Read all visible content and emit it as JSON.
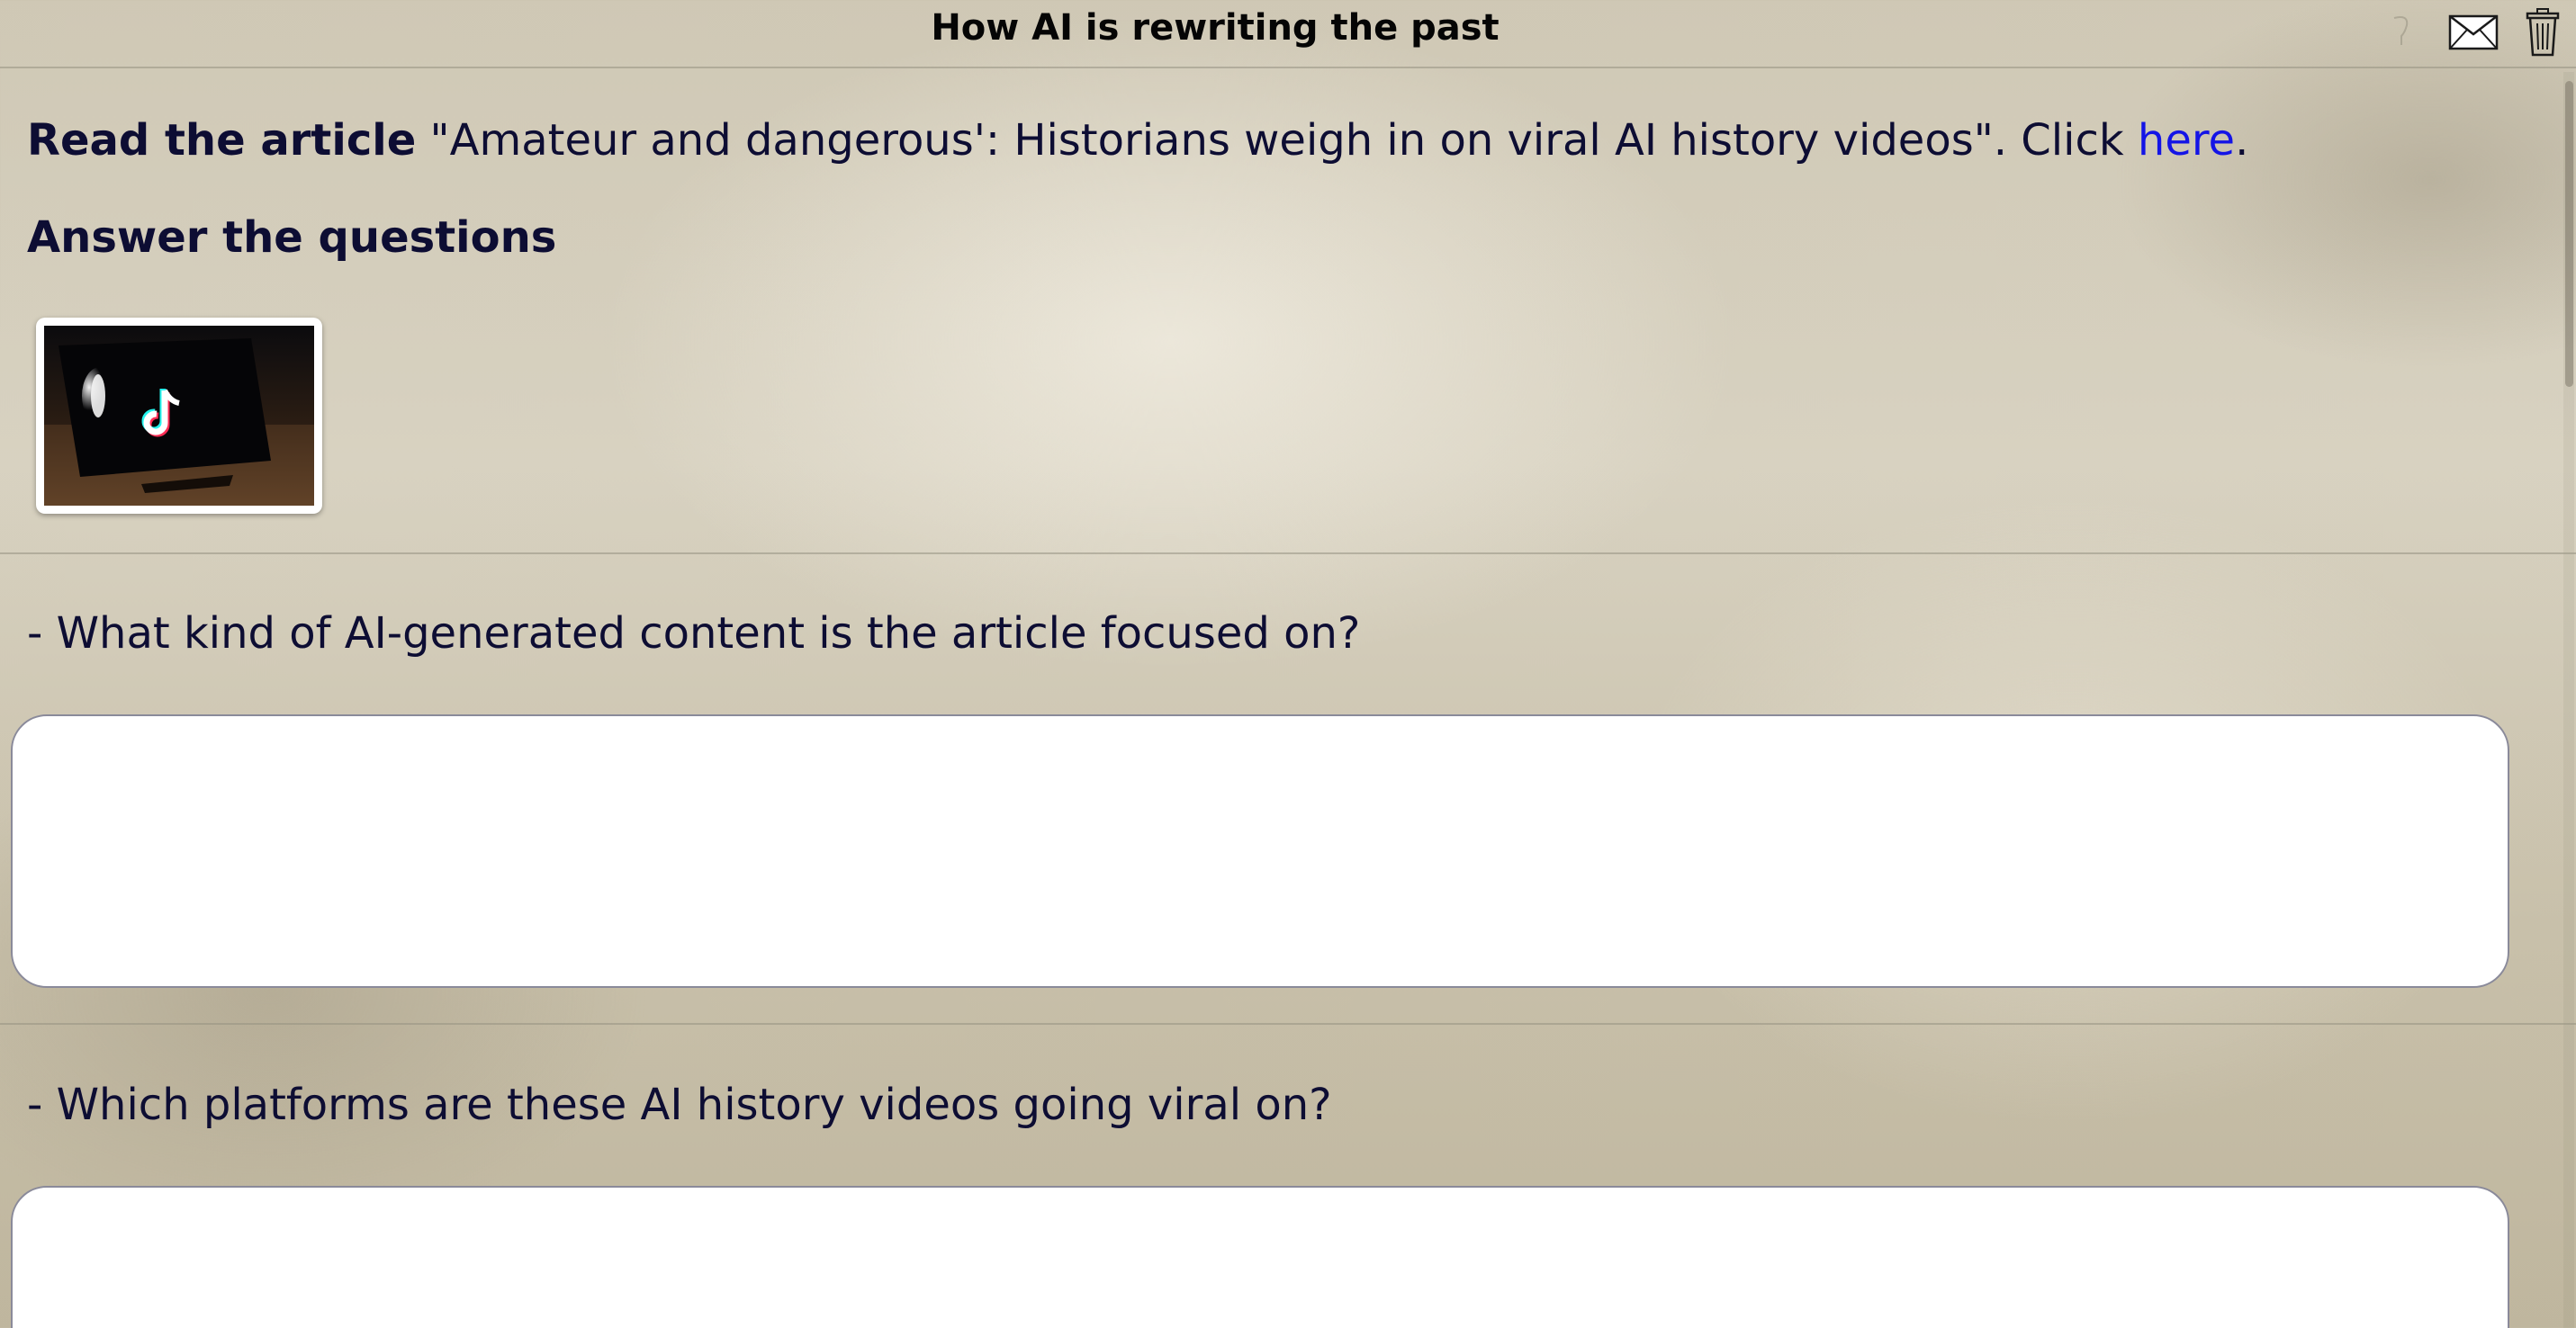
{
  "header": {
    "title": "How AI is rewriting the past",
    "icons": [
      "help-icon",
      "mail-icon",
      "trash-icon"
    ]
  },
  "intro": {
    "lead": "Read the article",
    "text_before_link": " \"Amateur and dangerous': Historians weigh in on viral AI history videos\". Click ",
    "link_text": "here",
    "text_after_link": "."
  },
  "instructions": "Answer the questions",
  "thumbnail": {
    "icon": "tiktok-logo-on-phone"
  },
  "questions": [
    {
      "text": "- What kind of AI-generated content is the article focused on?",
      "answer": ""
    },
    {
      "text": "- Which platforms are these AI history videos going viral on?",
      "answer": ""
    }
  ],
  "colors": {
    "text": "#0d0d33",
    "link": "#1414e6",
    "answer_background": "#ffffff"
  }
}
